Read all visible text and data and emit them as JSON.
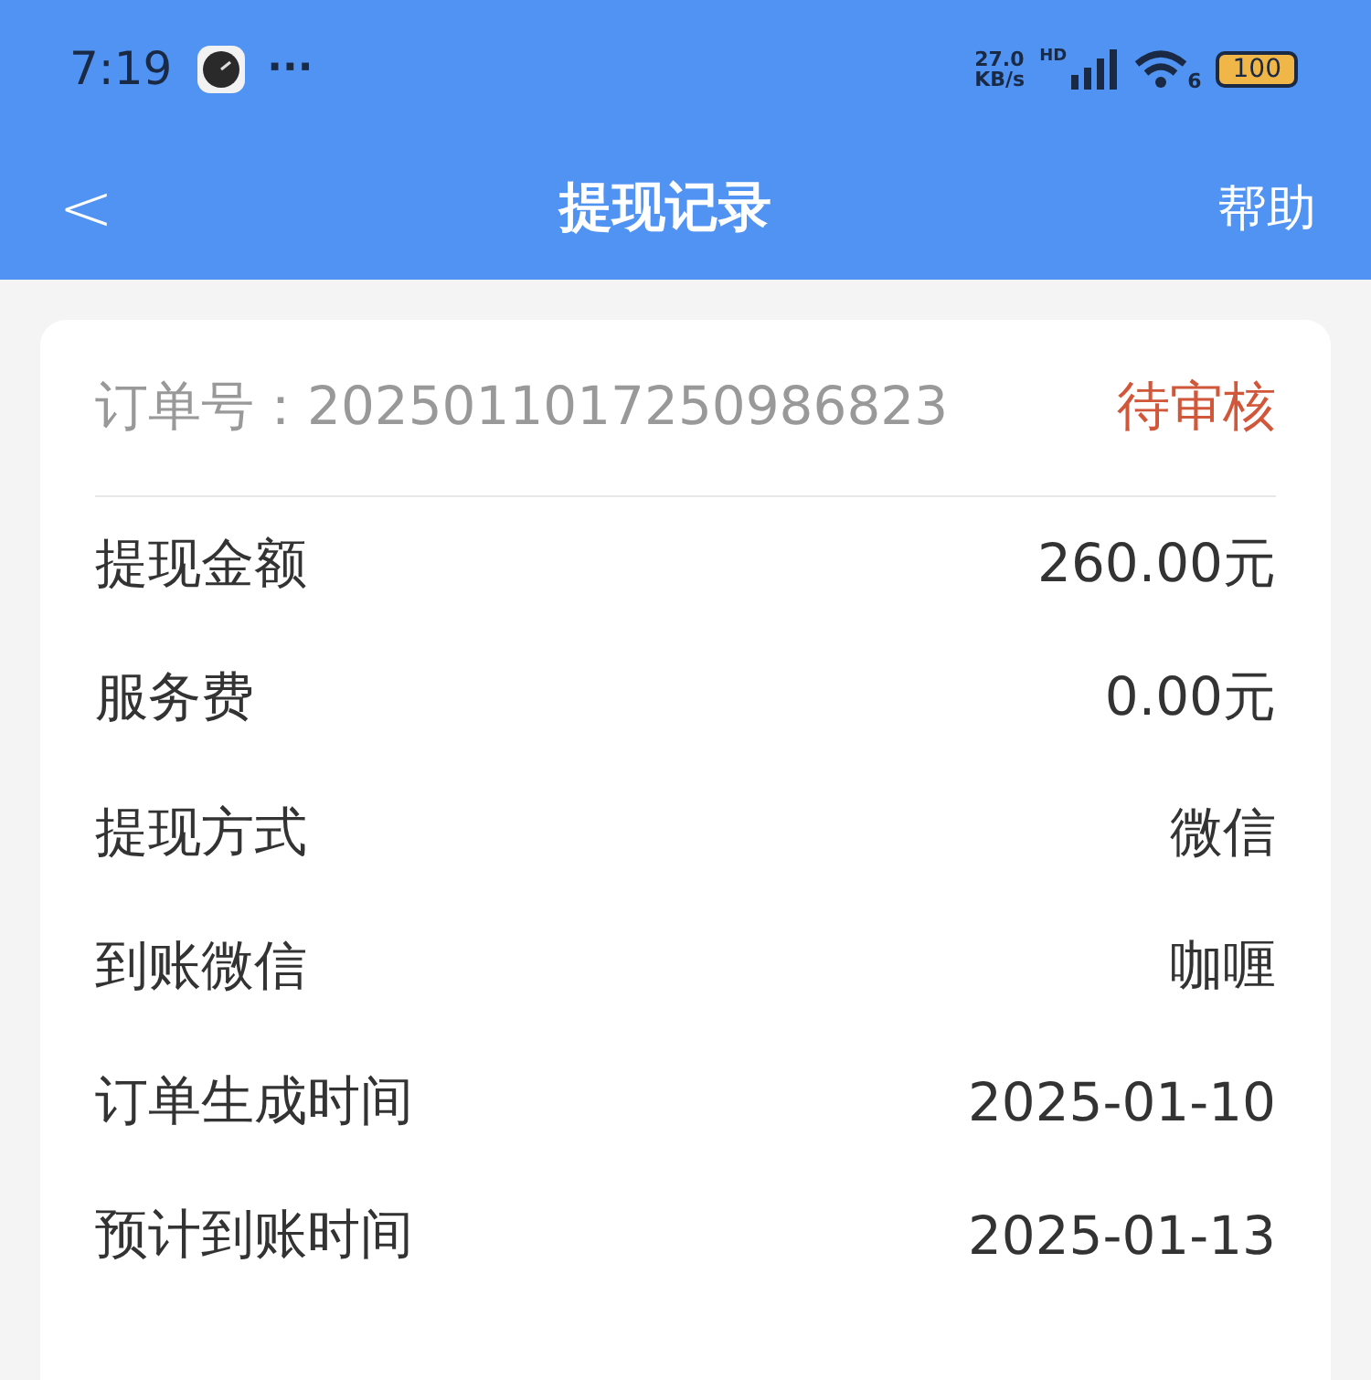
{
  "status_bar": {
    "time": "7:19",
    "more": "···",
    "speed_value": "27.0",
    "speed_unit": "KB/s",
    "network_badge": "HD",
    "wifi_badge": "6",
    "battery": "100"
  },
  "nav_bar": {
    "back": "<",
    "title": "提现记录",
    "help": "帮助"
  },
  "order": {
    "label": "订单号：",
    "number": "2025011017250986823",
    "status": "待审核",
    "kind": "pending"
  },
  "details": [
    {
      "label": "提现金额",
      "value": "260.00元"
    },
    {
      "label": "服务费",
      "value": "0.00元"
    },
    {
      "label": "提现方式",
      "value": "微信"
    },
    {
      "label": "到账微信",
      "value": "咖喱"
    },
    {
      "label": "订单生成时间",
      "value": "2025-01-10"
    },
    {
      "label": "预计到账时间",
      "value": "2025-01-13"
    }
  ]
}
